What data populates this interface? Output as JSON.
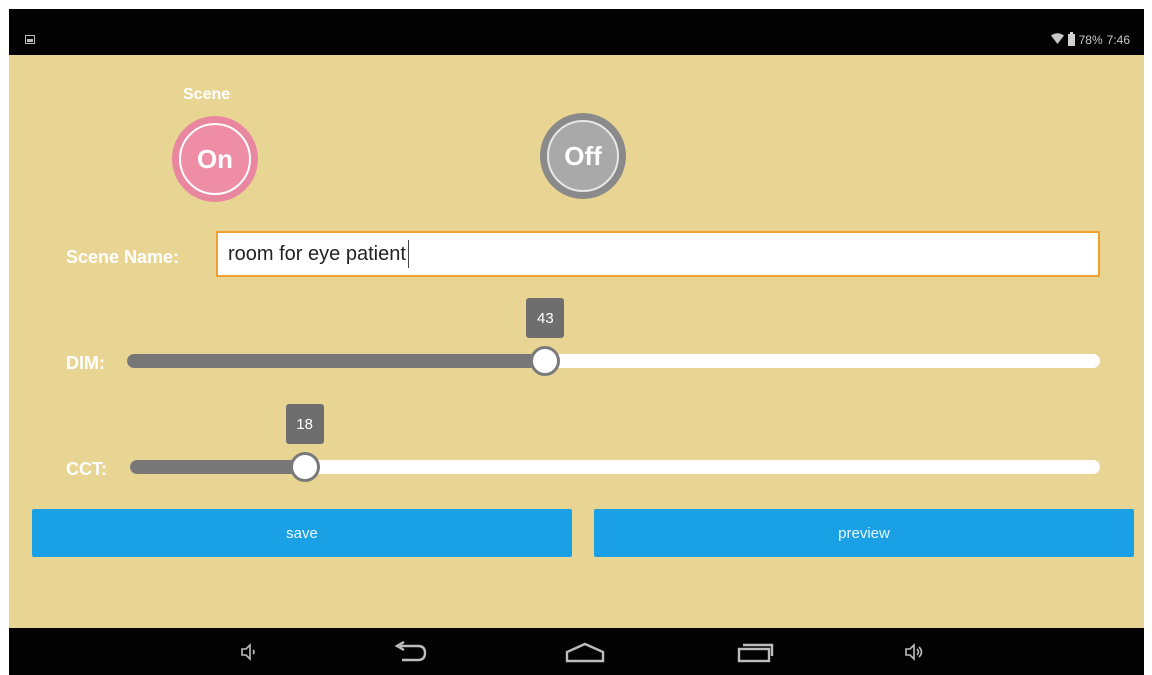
{
  "status_bar": {
    "battery": "78%",
    "time": "7:46"
  },
  "scene": {
    "label": "Scene",
    "on_label": "On",
    "off_label": "Off"
  },
  "scene_name": {
    "label": "Scene Name:",
    "value": "room for eye patient"
  },
  "dim": {
    "label": "DIM:",
    "value": "43",
    "level": 0.43
  },
  "cct": {
    "label": "CCT:",
    "value": "18",
    "level": 0.18
  },
  "actions": {
    "save_label": "save",
    "preview_label": "preview"
  },
  "colors": {
    "background": "#e9d593",
    "on_button": "#f08da6",
    "off_button": "#a9a9a9",
    "accent_blue": "#1aa0e5",
    "input_border": "#f0a030"
  },
  "icons": {
    "status_left": "notification-image-icon",
    "wifi": "wifi-icon",
    "battery": "battery-icon",
    "nav": [
      "volume-down-icon",
      "back-icon",
      "home-icon",
      "recents-icon",
      "volume-up-icon"
    ]
  }
}
